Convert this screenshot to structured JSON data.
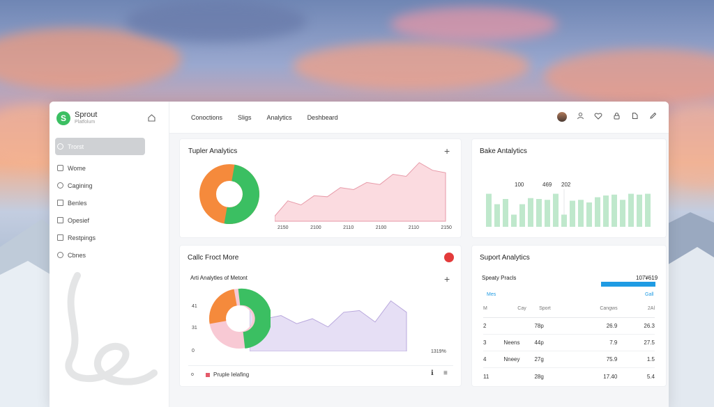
{
  "colors": {
    "green": "#3bbf62",
    "orange": "#f58a3c",
    "pink": "#f8c9d4",
    "lavender": "#e6dff5",
    "blue": "#1f9be3",
    "red": "#e33b3b"
  },
  "brand": {
    "name": "Sprout",
    "subtitle": "Platfolum"
  },
  "sidebar": {
    "items": [
      {
        "label": "Trorst",
        "active": true
      },
      {
        "label": "Wome"
      },
      {
        "label": "Cagining"
      },
      {
        "label": "Benles"
      },
      {
        "label": "Opesief"
      },
      {
        "label": "Restpings"
      },
      {
        "label": "Cbnes"
      }
    ]
  },
  "topbar": {
    "tabs": [
      "Conoctions",
      "Sligs",
      "Analytics",
      "Deshbeard"
    ],
    "icons": [
      "user-icon",
      "heart-icon",
      "lock-icon",
      "bookmark-icon",
      "pen-icon"
    ]
  },
  "card1": {
    "title": "Tupler Analytics",
    "x_labels": [
      "2150",
      "2100",
      "2110",
      "2100",
      "2110",
      "2150"
    ],
    "area_values": [
      10,
      40,
      32,
      50,
      48,
      66,
      62,
      76,
      72,
      92,
      88,
      115,
      100,
      95
    ]
  },
  "card2": {
    "title": "Bake Antalytics",
    "labels": [
      "100",
      "469",
      "202"
    ],
    "bar_values": [
      38,
      26,
      32,
      14,
      26,
      33,
      32,
      31,
      38,
      14,
      30,
      31,
      28,
      34,
      36,
      37,
      31,
      38,
      37,
      38
    ]
  },
  "card3": {
    "title": "Callc Froct More",
    "subtitle": "Arti Analytles of Metont",
    "y_labels": [
      "41",
      "31",
      "0"
    ],
    "x_label": "1319%",
    "legend": "Pruple Ielafing",
    "legend_left": "o",
    "area_values": [
      50,
      40,
      44,
      34,
      40,
      30,
      48,
      50,
      36,
      62,
      48
    ]
  },
  "card4": {
    "title": "Suport Analytics",
    "bar_label": "Speaty Pracls",
    "bar_value": "107¥619",
    "bar_fraction": 1.0,
    "tab_left": "Mes",
    "tab_right": "Gall",
    "columns": [
      "M",
      "Cay",
      "Sport",
      "Cangws",
      "2Al"
    ],
    "rows": [
      [
        "2",
        "",
        "78p",
        "26.9",
        "26.3"
      ],
      [
        "3",
        "Neens",
        "44p",
        "7.9",
        "27.5"
      ],
      [
        "4",
        "Nneey",
        "27g",
        "75.9",
        "1.5"
      ],
      [
        "11",
        "",
        "28g",
        "17.40",
        "5.4"
      ]
    ]
  }
}
